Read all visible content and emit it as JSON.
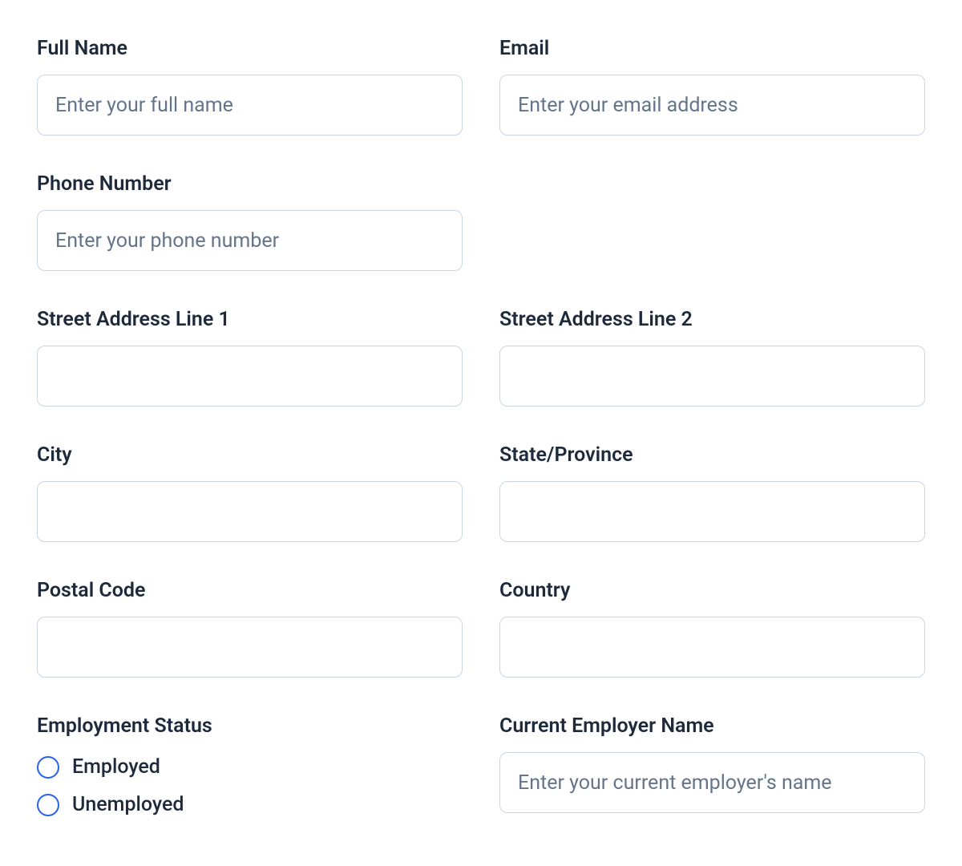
{
  "fields": {
    "fullName": {
      "label": "Full Name",
      "placeholder": "Enter your full name",
      "value": ""
    },
    "email": {
      "label": "Email",
      "placeholder": "Enter your email address",
      "value": ""
    },
    "phone": {
      "label": "Phone Number",
      "placeholder": "Enter your phone number",
      "value": ""
    },
    "street1": {
      "label": "Street Address Line 1",
      "placeholder": "",
      "value": ""
    },
    "street2": {
      "label": "Street Address Line 2",
      "placeholder": "",
      "value": ""
    },
    "city": {
      "label": "City",
      "placeholder": "",
      "value": ""
    },
    "state": {
      "label": "State/Province",
      "placeholder": "",
      "value": ""
    },
    "postal": {
      "label": "Postal Code",
      "placeholder": "",
      "value": ""
    },
    "country": {
      "label": "Country",
      "placeholder": "",
      "value": ""
    },
    "employmentStatus": {
      "label": "Employment Status",
      "options": [
        "Employed",
        "Unemployed"
      ]
    },
    "employerName": {
      "label": "Current Employer Name",
      "placeholder": "Enter your current employer's name",
      "value": ""
    }
  }
}
